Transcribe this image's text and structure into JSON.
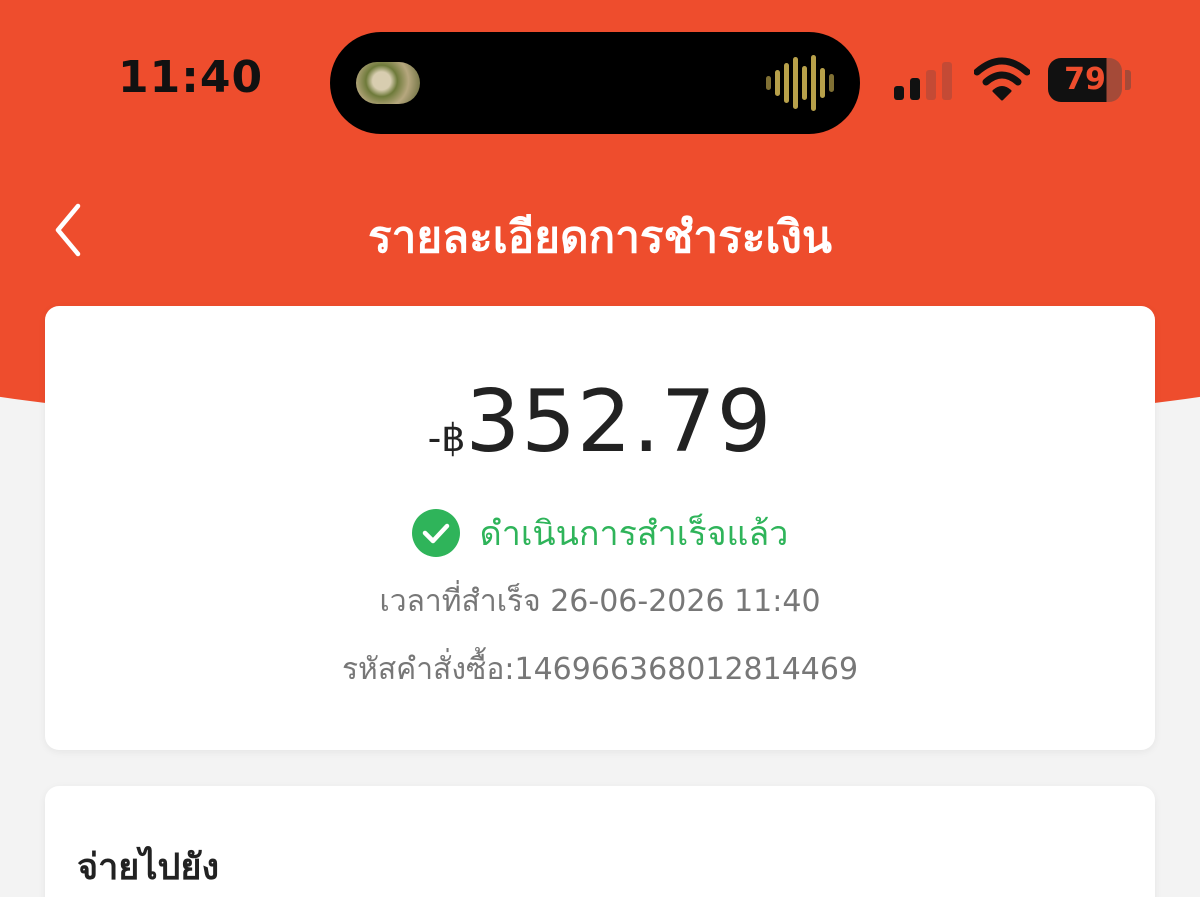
{
  "status_bar": {
    "time": "11:40",
    "battery": "79"
  },
  "header": {
    "title": "รายละเอียดการชำระเงิน"
  },
  "payment": {
    "currency_prefix": "-฿",
    "amount": "352.79",
    "status": "ดำเนินการสำเร็จแล้ว",
    "completed_time": "เวลาที่สำเร็จ 26-06-2026 11:40",
    "order_id": "รหัสคำสั่งซื้อ:146966368012814469"
  },
  "pay_to": {
    "title": "จ่ายไปยัง"
  },
  "colors": {
    "brand": "#ee4d2d",
    "success": "#2fb45a"
  }
}
